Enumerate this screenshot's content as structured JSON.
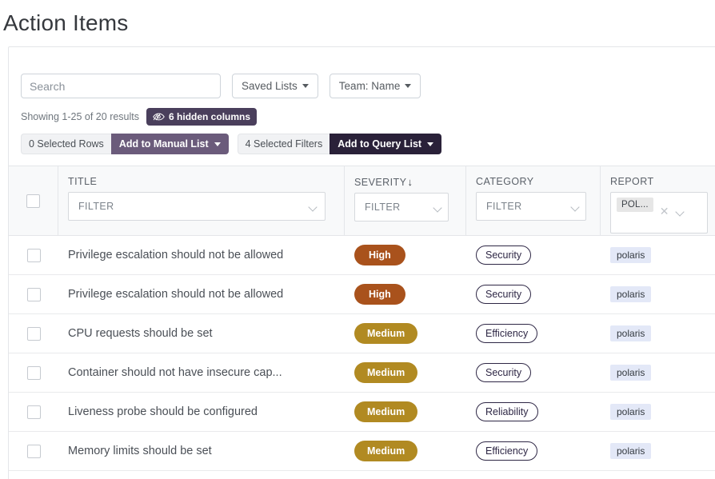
{
  "page": {
    "title": "Action Items"
  },
  "toolbar": {
    "search_placeholder": "Search",
    "search_value": "",
    "saved_lists_label": "Saved Lists",
    "team_filter_label": "Team: Name"
  },
  "meta": {
    "results_text": "Showing 1-25 of 20 results",
    "hidden_columns_label": "6 hidden columns"
  },
  "actions": {
    "selected_rows_label": "0 Selected Rows",
    "add_to_manual_list_label": "Add to Manual List",
    "selected_filters_label": "4 Selected Filters",
    "add_to_query_list_label": "Add to Query List"
  },
  "table": {
    "columns": [
      {
        "key": "title",
        "header": "TITLE",
        "filter_placeholder": "FILTER",
        "sorted": false
      },
      {
        "key": "severity",
        "header": "SEVERITY",
        "filter_placeholder": "FILTER",
        "sorted": true,
        "sort_arrow": "↓"
      },
      {
        "key": "category",
        "header": "CATEGORY",
        "filter_placeholder": "FILTER",
        "sorted": false
      },
      {
        "key": "report",
        "header": "REPORT",
        "filter_chip": "POL...",
        "sorted": false
      }
    ],
    "rows": [
      {
        "selected": false,
        "title": "Privilege escalation should not be allowed",
        "severity": "High",
        "category": "Security",
        "report": "polaris"
      },
      {
        "selected": false,
        "title": "Privilege escalation should not be allowed",
        "severity": "High",
        "category": "Security",
        "report": "polaris"
      },
      {
        "selected": false,
        "title": "CPU requests should be set",
        "severity": "Medium",
        "category": "Efficiency",
        "report": "polaris"
      },
      {
        "selected": false,
        "title": "Container should not have insecure cap...",
        "severity": "Medium",
        "category": "Security",
        "report": "polaris"
      },
      {
        "selected": false,
        "title": "Liveness probe should be configured",
        "severity": "Medium",
        "category": "Reliability",
        "report": "polaris"
      },
      {
        "selected": false,
        "title": "Memory limits should be set",
        "severity": "Medium",
        "category": "Efficiency",
        "report": "polaris"
      }
    ]
  },
  "colors": {
    "severity_high": "#a9521c",
    "severity_medium": "#b18a22",
    "badge_hidden_columns": "#4a3f5c",
    "btn_manual_list": "#6b5b7b",
    "btn_query_list": "#2a2139",
    "tag_polaris_bg": "#e3e8f7",
    "category_outline": "#2e2745"
  }
}
